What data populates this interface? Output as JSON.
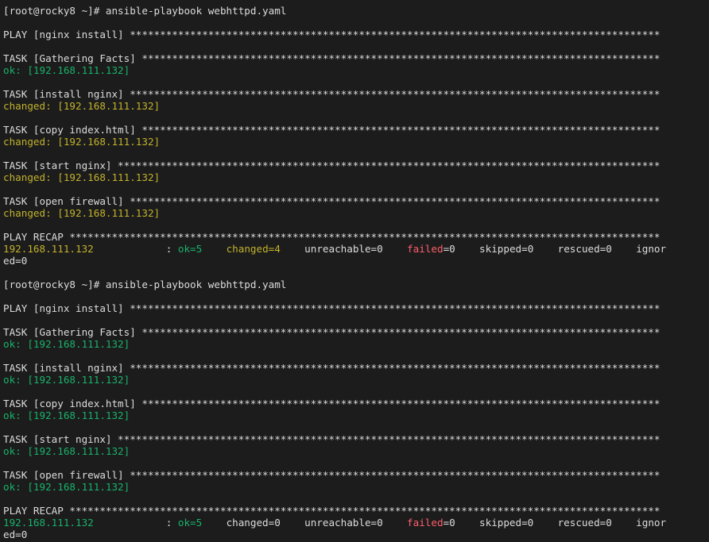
{
  "window": {
    "background": "#1c1c1c"
  },
  "colors": {
    "default": "#dcdcdc",
    "ok": "#19b26b",
    "changed": "#c2b22d",
    "failed": "#ff5f6d",
    "partial": "#c45cc9"
  },
  "terminal": {
    "lines": [
      {
        "kind": "partial",
        "segments": [
          {
            "text": "    ************",
            "color": "partial"
          }
        ]
      },
      {
        "kind": "text",
        "segments": [
          {
            "text": "[root@rocky8 ~]# ansible-playbook webhttpd.yaml",
            "color": "default"
          }
        ]
      },
      {
        "kind": "blank",
        "segments": []
      },
      {
        "kind": "text",
        "segments": [
          {
            "text": "PLAY [nginx install] ****************************************************************************************",
            "color": "default"
          }
        ]
      },
      {
        "kind": "blank",
        "segments": []
      },
      {
        "kind": "text",
        "segments": [
          {
            "text": "TASK [Gathering Facts] **************************************************************************************",
            "color": "default"
          }
        ]
      },
      {
        "kind": "text",
        "segments": [
          {
            "text": "ok: [192.168.111.132]",
            "color": "ok"
          }
        ]
      },
      {
        "kind": "blank",
        "segments": []
      },
      {
        "kind": "text",
        "segments": [
          {
            "text": "TASK [install nginx] ****************************************************************************************",
            "color": "default"
          }
        ]
      },
      {
        "kind": "text",
        "segments": [
          {
            "text": "changed: [192.168.111.132]",
            "color": "changed"
          }
        ]
      },
      {
        "kind": "blank",
        "segments": []
      },
      {
        "kind": "text",
        "segments": [
          {
            "text": "TASK [copy index.html] **************************************************************************************",
            "color": "default"
          }
        ]
      },
      {
        "kind": "text",
        "segments": [
          {
            "text": "changed: [192.168.111.132]",
            "color": "changed"
          }
        ]
      },
      {
        "kind": "blank",
        "segments": []
      },
      {
        "kind": "text",
        "segments": [
          {
            "text": "TASK [start nginx] ******************************************************************************************",
            "color": "default"
          }
        ]
      },
      {
        "kind": "text",
        "segments": [
          {
            "text": "changed: [192.168.111.132]",
            "color": "changed"
          }
        ]
      },
      {
        "kind": "blank",
        "segments": []
      },
      {
        "kind": "text",
        "segments": [
          {
            "text": "TASK [open firewall] ****************************************************************************************",
            "color": "default"
          }
        ]
      },
      {
        "kind": "text",
        "segments": [
          {
            "text": "changed: [192.168.111.132]",
            "color": "changed"
          }
        ]
      },
      {
        "kind": "blank",
        "segments": []
      },
      {
        "kind": "text",
        "segments": [
          {
            "text": "PLAY RECAP **************************************************************************************************",
            "color": "default"
          }
        ]
      },
      {
        "kind": "text",
        "segments": [
          {
            "text": "192.168.111.132",
            "color": "changed"
          },
          {
            "text": "            : ",
            "color": "default"
          },
          {
            "text": "ok=5",
            "color": "ok"
          },
          {
            "text": "    ",
            "color": "default"
          },
          {
            "text": "changed=4",
            "color": "changed"
          },
          {
            "text": "    unreachable=0    ",
            "color": "default"
          },
          {
            "text": "failed",
            "color": "failed"
          },
          {
            "text": "=0    skipped=0    rescued=0    ignor",
            "color": "default"
          }
        ]
      },
      {
        "kind": "text",
        "segments": [
          {
            "text": "ed=0",
            "color": "default"
          }
        ]
      },
      {
        "kind": "blank",
        "segments": []
      },
      {
        "kind": "text",
        "segments": [
          {
            "text": "[root@rocky8 ~]# ansible-playbook webhttpd.yaml",
            "color": "default"
          }
        ]
      },
      {
        "kind": "blank",
        "segments": []
      },
      {
        "kind": "text",
        "segments": [
          {
            "text": "PLAY [nginx install] ****************************************************************************************",
            "color": "default"
          }
        ]
      },
      {
        "kind": "blank",
        "segments": []
      },
      {
        "kind": "text",
        "segments": [
          {
            "text": "TASK [Gathering Facts] **************************************************************************************",
            "color": "default"
          }
        ]
      },
      {
        "kind": "text",
        "segments": [
          {
            "text": "ok: [192.168.111.132]",
            "color": "ok"
          }
        ]
      },
      {
        "kind": "blank",
        "segments": []
      },
      {
        "kind": "text",
        "segments": [
          {
            "text": "TASK [install nginx] ****************************************************************************************",
            "color": "default"
          }
        ]
      },
      {
        "kind": "text",
        "segments": [
          {
            "text": "ok: [192.168.111.132]",
            "color": "ok"
          }
        ]
      },
      {
        "kind": "blank",
        "segments": []
      },
      {
        "kind": "text",
        "segments": [
          {
            "text": "TASK [copy index.html] **************************************************************************************",
            "color": "default"
          }
        ]
      },
      {
        "kind": "text",
        "segments": [
          {
            "text": "ok: [192.168.111.132]",
            "color": "ok"
          }
        ]
      },
      {
        "kind": "blank",
        "segments": []
      },
      {
        "kind": "text",
        "segments": [
          {
            "text": "TASK [start nginx] ******************************************************************************************",
            "color": "default"
          }
        ]
      },
      {
        "kind": "text",
        "segments": [
          {
            "text": "ok: [192.168.111.132]",
            "color": "ok"
          }
        ]
      },
      {
        "kind": "blank",
        "segments": []
      },
      {
        "kind": "text",
        "segments": [
          {
            "text": "TASK [open firewall] ****************************************************************************************",
            "color": "default"
          }
        ]
      },
      {
        "kind": "text",
        "segments": [
          {
            "text": "ok: [192.168.111.132]",
            "color": "ok"
          }
        ]
      },
      {
        "kind": "blank",
        "segments": []
      },
      {
        "kind": "text",
        "segments": [
          {
            "text": "PLAY RECAP **************************************************************************************************",
            "color": "default"
          }
        ]
      },
      {
        "kind": "text",
        "segments": [
          {
            "text": "192.168.111.132",
            "color": "ok"
          },
          {
            "text": "            : ",
            "color": "default"
          },
          {
            "text": "ok=5",
            "color": "ok"
          },
          {
            "text": "    changed=0    unreachable=0    ",
            "color": "default"
          },
          {
            "text": "failed",
            "color": "failed"
          },
          {
            "text": "=0    skipped=0    rescued=0    ignor",
            "color": "default"
          }
        ]
      },
      {
        "kind": "text",
        "segments": [
          {
            "text": "ed=0",
            "color": "default"
          }
        ]
      }
    ]
  }
}
